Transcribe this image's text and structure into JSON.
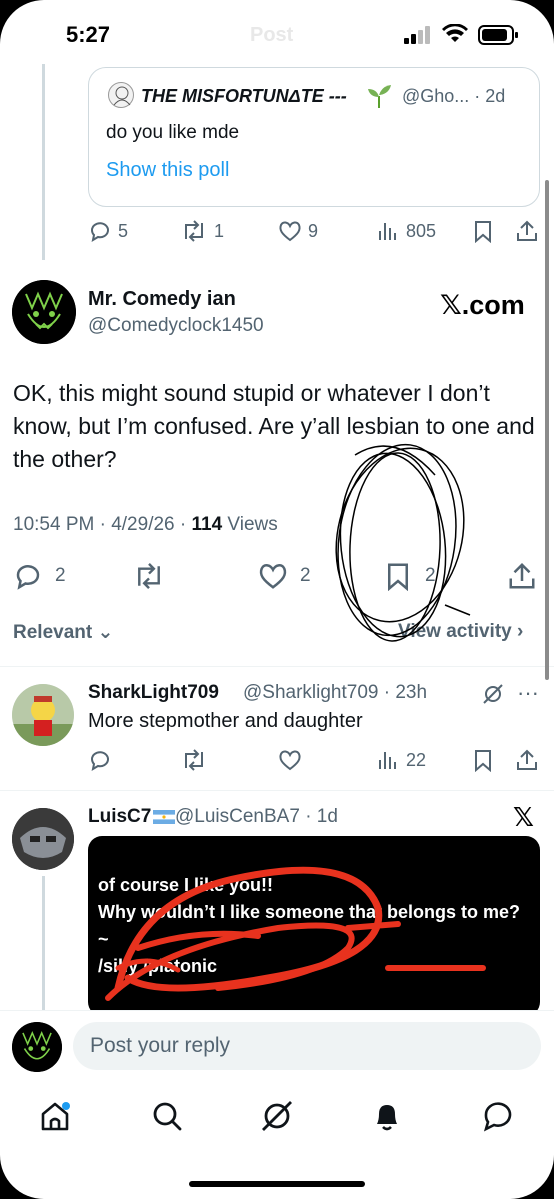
{
  "status_bar": {
    "time": "5:27",
    "ghost_title": "Post"
  },
  "quote": {
    "name": "THE MISFORTUNΔTE ---",
    "handle_date": "@Gho... · 2d",
    "text": "do you like mde",
    "poll_link": "Show this poll",
    "actions": {
      "replies": "5",
      "reposts": "1",
      "likes": "9",
      "views": "805"
    }
  },
  "main_post": {
    "name": "Mr. Comedy ian",
    "handle": "@Comedyclock1450",
    "source": "𝕏.com",
    "text": "OK, this might sound stupid or whatever I don’t know, but I’m confused. Are y’all lesbian to one and the other?",
    "time_date": "10:54 PM · 4/29/26 · ",
    "views_count": "114",
    "views_label": " Views",
    "actions": {
      "replies": "2",
      "likes": "2",
      "bookmarks": "2"
    }
  },
  "sort": {
    "label": "Relevant",
    "view_activity": "View activity"
  },
  "replies": [
    {
      "name": "SharkLight709",
      "handle_date": "@Sharklight709 · 23h",
      "text": "More stepmother and daughter",
      "views": "22"
    },
    {
      "name": "LuisC7",
      "handle_date": "@LuisCenBA7 · 1d",
      "source": "𝕏",
      "media_text": "of course I like you!!\nWhy wouldn’t I like someone that belongs to me?~\n/silly /platonic"
    }
  ],
  "composer": {
    "placeholder": "Post your reply"
  },
  "colors": {
    "accent": "#1d9bf0",
    "text": "#0f1419",
    "muted": "#536471",
    "scribble": "#e8321e"
  },
  "icons": [
    "reply-icon",
    "repost-icon",
    "like-icon",
    "views-icon",
    "bookmark-icon",
    "share-icon",
    "grok-icon",
    "more-icon",
    "home-icon",
    "search-icon",
    "bell-icon",
    "messages-icon"
  ]
}
